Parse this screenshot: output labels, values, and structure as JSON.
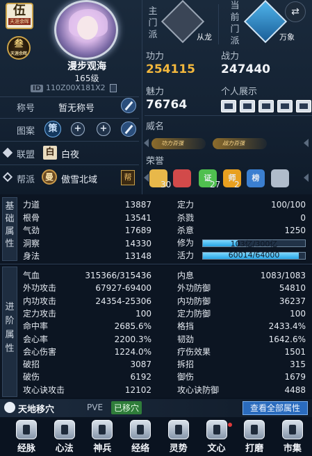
{
  "profile": {
    "rank_char": "伍",
    "rank_title": "天涯余晖",
    "seal_char": "叁",
    "seal_sub": "天涯余晖",
    "name": "漫步观海",
    "level": "165级",
    "id_tag": "ID",
    "id_value": "110Z00X181X2",
    "title_label": "称号",
    "title_value": "暂无称号",
    "pattern_label": "图案",
    "pattern_char": "策",
    "alliance_label": "联盟",
    "alliance_badge": "白",
    "alliance_name": "白夜",
    "guild_label": "帮派",
    "guild_badge": "曼",
    "guild_name": "傲雪北域",
    "guild_icon": "帮"
  },
  "sects": {
    "main_label": "主门派",
    "main_name": "从龙",
    "current_label": "当前门派",
    "current_name": "万象"
  },
  "stats_top": {
    "gongli_label": "功力",
    "gongli": "254115",
    "zhanli_label": "战力",
    "zhanli": "247440",
    "meili_label": "魅力",
    "meili": "76764",
    "show_label": "个人展示",
    "weiming_label": "威名",
    "weiming_badges": [
      "功力百强",
      "战力百强"
    ],
    "honor_label": "荣誉",
    "honors": [
      {
        "icon": "fan-icon",
        "count": "30",
        "color": "#e8b84a"
      },
      {
        "icon": "drum-icon",
        "count": "",
        "color": "#d24a4a"
      },
      {
        "icon": "certificate-icon",
        "text": "证",
        "count": "27",
        "color": "#4fbf4f"
      },
      {
        "icon": "master-icon",
        "text": "师",
        "count": "2",
        "color": "#e8a020"
      },
      {
        "icon": "ranking-icon",
        "text": "榜",
        "count": "",
        "color": "#3b7fd0"
      },
      {
        "icon": "jade-icon",
        "count": "",
        "color": "#b0bccb"
      }
    ]
  },
  "basic": {
    "tab_label": "基础属性",
    "left": [
      {
        "k": "力道",
        "v": "13887"
      },
      {
        "k": "根骨",
        "v": "13541"
      },
      {
        "k": "气劲",
        "v": "17689"
      },
      {
        "k": "洞察",
        "v": "14330"
      },
      {
        "k": "身法",
        "v": "13148"
      }
    ],
    "right": [
      {
        "k": "定力",
        "v": "100/100"
      },
      {
        "k": "杀戮",
        "v": "0"
      },
      {
        "k": "杀意",
        "v": "1250"
      }
    ],
    "xiuwei_label": "修为",
    "xiuwei_text": "103亿/300亿",
    "xiuwei_progress": 0.343,
    "huoli_label": "活力",
    "huoli_text": "60014/64000",
    "huoli_progress": 0.938
  },
  "advanced": {
    "tab_label": "进阶属性",
    "left": [
      {
        "k": "气血",
        "v": "315366/315436"
      },
      {
        "k": "外功攻击",
        "v": "67927-69400"
      },
      {
        "k": "内功攻击",
        "v": "24354-25306"
      },
      {
        "k": "定力攻击",
        "v": "100"
      },
      {
        "k": "命中率",
        "v": "2685.6%"
      },
      {
        "k": "会心率",
        "v": "2200.3%"
      },
      {
        "k": "会心伤害",
        "v": "1224.0%"
      },
      {
        "k": "破招",
        "v": "3087"
      },
      {
        "k": "破伤",
        "v": "6192"
      },
      {
        "k": "攻心诀攻击",
        "v": "12102"
      }
    ],
    "right": [
      {
        "k": "内息",
        "v": "1083/1083"
      },
      {
        "k": "外功防御",
        "v": "54810"
      },
      {
        "k": "内功防御",
        "v": "36237"
      },
      {
        "k": "定力防御",
        "v": "100"
      },
      {
        "k": "格挡",
        "v": "2433.4%"
      },
      {
        "k": "韧劲",
        "v": "1642.6%"
      },
      {
        "k": "疗伤效果",
        "v": "1501"
      },
      {
        "k": "拆招",
        "v": "315"
      },
      {
        "k": "御伤",
        "v": "1679"
      },
      {
        "k": "攻心诀防御",
        "v": "4488"
      }
    ]
  },
  "movebar": {
    "title": "天地移穴",
    "mode": "PVE",
    "status": "已移穴",
    "view_all": "查看全部属性"
  },
  "bottom_tabs": [
    "经脉",
    "心法",
    "神兵",
    "经络",
    "灵势",
    "文心",
    "打磨",
    "市集"
  ]
}
